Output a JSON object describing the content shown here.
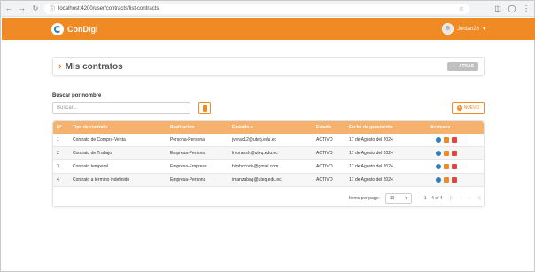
{
  "browser": {
    "url": "localhost:4200/user/contracts/list-contracts"
  },
  "header": {
    "brand": "ConDigi",
    "username": "Jordan26"
  },
  "page": {
    "title": "Mis contratos",
    "back_label": "ATRAS"
  },
  "search": {
    "label": "Buscar por nombre",
    "placeholder": "Buscar..."
  },
  "new_button": "NUEVO",
  "table": {
    "columns": [
      "N°",
      "Tipo de contrato",
      "Realización",
      "Enviado a",
      "Estado",
      "Fecha de generación",
      "Acciones"
    ],
    "rows": [
      {
        "n": "1",
        "tipo": "Contrato de Compra-Venta",
        "realizacion": "Persona-Persona",
        "enviado": "jverac12@uteq.edu.ec",
        "estado": "ACTIVO",
        "fecha": "17 de Agosto del 2024"
      },
      {
        "n": "2",
        "tipo": "Contrato de Trabajo",
        "realizacion": "Empresa-Persona",
        "enviado": "lmoraesh@uteq.edu.ec",
        "estado": "ACTIVO",
        "fecha": "17 de Agosto del 2024"
      },
      {
        "n": "3",
        "tipo": "Contrato temporal",
        "realizacion": "Empresa-Empresa",
        "enviado": "bimbocode@gmail.com",
        "estado": "ACTIVO",
        "fecha": "17 de Agosto del 2024"
      },
      {
        "n": "4",
        "tipo": "Contrato a término indefinido",
        "realizacion": "Empresa-Persona",
        "enviado": "imanzabag@uteq.edu.ec",
        "estado": "ACTIVO",
        "fecha": "17 de Agosto del 2024"
      }
    ]
  },
  "paginator": {
    "items_per_page_label": "Items per page:",
    "items_per_page": "10",
    "range": "1 – 4 of 4"
  },
  "colors": {
    "brand": "#f08a24",
    "header_row": "#f5b26f",
    "view_icon": "#2a7fbf",
    "delete_icon": "#e0473d"
  }
}
